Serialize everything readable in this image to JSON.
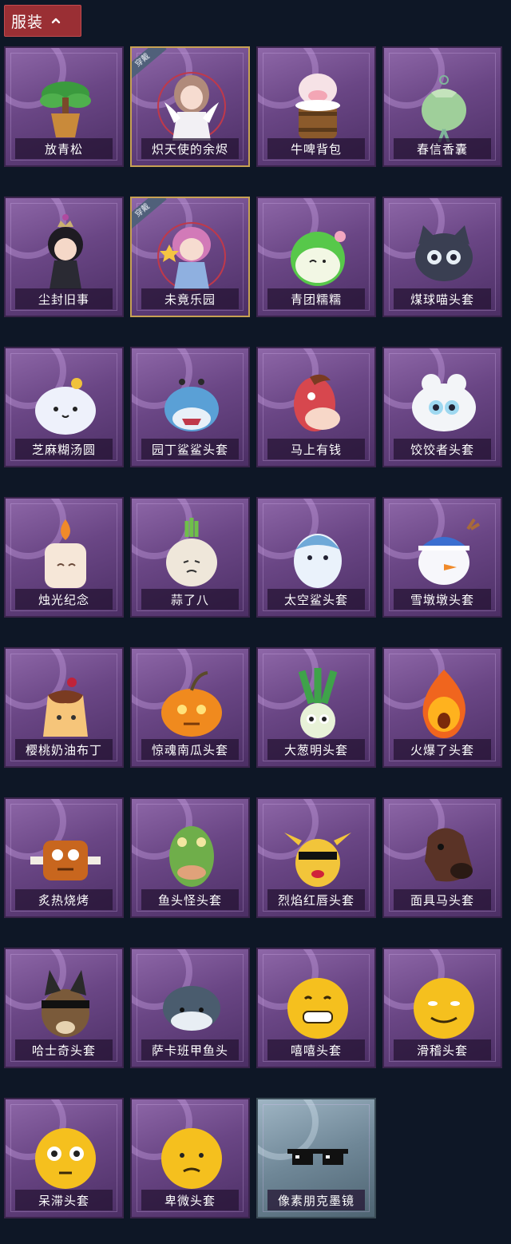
{
  "header": {
    "tab_label": "服装"
  },
  "items": [
    {
      "name": "放青松",
      "icon": "bonsai-pine-icon"
    },
    {
      "name": "炽天使的余烬",
      "icon": "angel-doll-icon",
      "badge": "穿戴"
    },
    {
      "name": "牛啤背包",
      "icon": "cow-barrel-icon"
    },
    {
      "name": "春信香囊",
      "icon": "sachet-icon"
    },
    {
      "name": "尘封旧事",
      "icon": "chibi-king-icon"
    },
    {
      "name": "未竟乐园",
      "icon": "star-girl-icon",
      "badge": "穿戴"
    },
    {
      "name": "青团糯糯",
      "icon": "green-dumpling-icon"
    },
    {
      "name": "煤球喵头套",
      "icon": "black-cat-head-icon"
    },
    {
      "name": "芝麻糊汤圆",
      "icon": "rice-ball-icon"
    },
    {
      "name": "园丁鲨鲨头套",
      "icon": "bee-shark-head-icon"
    },
    {
      "name": "马上有钱",
      "icon": "red-horse-icon"
    },
    {
      "name": "饺饺者头套",
      "icon": "dumpling-head-icon"
    },
    {
      "name": "烛光纪念",
      "icon": "candle-icon"
    },
    {
      "name": "蒜了八",
      "icon": "garlic-icon"
    },
    {
      "name": "太空鲨头套",
      "icon": "space-shark-head-icon"
    },
    {
      "name": "雪墩墩头套",
      "icon": "snowman-head-icon"
    },
    {
      "name": "樱桃奶油布丁",
      "icon": "pudding-icon"
    },
    {
      "name": "惊魂南瓜头套",
      "icon": "pumpkin-head-icon"
    },
    {
      "name": "大葱明头套",
      "icon": "scallion-head-icon"
    },
    {
      "name": "火爆了头套",
      "icon": "fire-head-icon"
    },
    {
      "name": "炙热烧烤",
      "icon": "bbq-meat-icon"
    },
    {
      "name": "鱼头怪头套",
      "icon": "fish-head-icon"
    },
    {
      "name": "烈焰红唇头套",
      "icon": "pikachu-lips-head-icon"
    },
    {
      "name": "面具马头套",
      "icon": "horse-mask-icon"
    },
    {
      "name": "哈士奇头套",
      "icon": "husky-head-icon"
    },
    {
      "name": "萨卡班甲鱼头",
      "icon": "sacabambaspis-head-icon"
    },
    {
      "name": "嘻嘻头套",
      "icon": "grin-emoji-head-icon"
    },
    {
      "name": "滑稽头套",
      "icon": "smirk-emoji-head-icon"
    },
    {
      "name": "呆滞头套",
      "icon": "flushed-emoji-head-icon"
    },
    {
      "name": "卑微头套",
      "icon": "pleading-emoji-head-icon"
    },
    {
      "name": "像素朋克墨镜",
      "icon": "pixel-sunglasses-icon",
      "frame": "glass"
    }
  ],
  "colors": {
    "background": "#0e1726",
    "tab": "#9a2f34",
    "card_purple": "#7a56a0",
    "card_glass": "#7f98a8",
    "equipped_border": "#c7a153",
    "badge": "#50607a"
  }
}
